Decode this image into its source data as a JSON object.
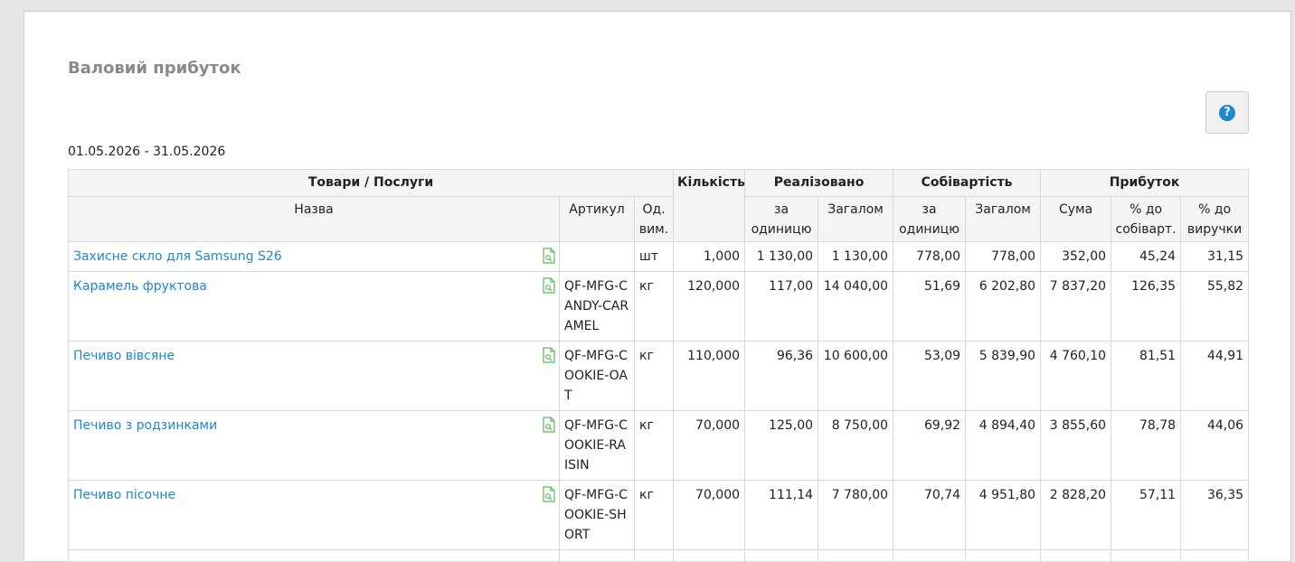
{
  "page": {
    "title": "Валовий прибуток",
    "period": "01.05.2026 - 31.05.2026",
    "help_glyph": "?"
  },
  "colors": {
    "link": "#1f86d3",
    "title": "#8a8a8a",
    "doc_icon": "#5cb85c",
    "header_bg": "#f4f4f4"
  },
  "table": {
    "group_headers": {
      "goods": "Товари / Послуги",
      "quantity": "Кількість",
      "sold": "Реалізовано",
      "cost": "Собівартість",
      "profit": "Прибуток"
    },
    "sub_headers": {
      "name": "Назва",
      "sku": "Артикул",
      "unit": "Од. вим.",
      "sold_per_unit": "за одиницю",
      "sold_total": "Загалом",
      "cost_per_unit": "за одиницю",
      "cost_total": "Загалом",
      "profit_sum": "Сума",
      "pct_cost": "% до собіварт.",
      "pct_revenue": "% до виручки"
    },
    "rows": [
      {
        "name": "Захисне скло для Samsung S26",
        "sku": "",
        "unit": "шт",
        "qty": "1,000",
        "sold_unit": "1 130,00",
        "sold_total": "1 130,00",
        "cost_unit": "778,00",
        "cost_total": "778,00",
        "profit": "352,00",
        "pct_cost": "45,24",
        "pct_rev": "31,15"
      },
      {
        "name": "Карамель фруктова",
        "sku": "QF-MFG-CANDY-CARAMEL",
        "unit": "кг",
        "qty": "120,000",
        "sold_unit": "117,00",
        "sold_total": "14 040,00",
        "cost_unit": "51,69",
        "cost_total": "6 202,80",
        "profit": "7 837,20",
        "pct_cost": "126,35",
        "pct_rev": "55,82"
      },
      {
        "name": "Печиво вівсяне",
        "sku": "QF-MFG-COOKIE-OAT",
        "unit": "кг",
        "qty": "110,000",
        "sold_unit": "96,36",
        "sold_total": "10 600,00",
        "cost_unit": "53,09",
        "cost_total": "5 839,90",
        "profit": "4 760,10",
        "pct_cost": "81,51",
        "pct_rev": "44,91"
      },
      {
        "name": "Печиво з родзинками",
        "sku": "QF-MFG-COOKIE-RAISIN",
        "unit": "кг",
        "qty": "70,000",
        "sold_unit": "125,00",
        "sold_total": "8 750,00",
        "cost_unit": "69,92",
        "cost_total": "4 894,40",
        "profit": "3 855,60",
        "pct_cost": "78,78",
        "pct_rev": "44,06"
      },
      {
        "name": "Печиво пісочне",
        "sku": "QF-MFG-COOKIE-SHORT",
        "unit": "кг",
        "qty": "70,000",
        "sold_unit": "111,14",
        "sold_total": "7 780,00",
        "cost_unit": "70,74",
        "cost_total": "4 951,80",
        "profit": "2 828,20",
        "pct_cost": "57,11",
        "pct_rev": "36,35"
      }
    ]
  }
}
